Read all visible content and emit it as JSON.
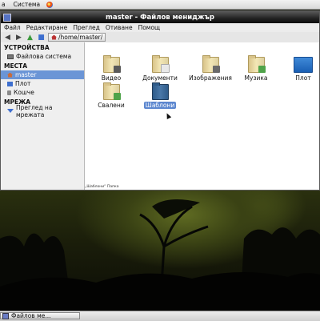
{
  "top_panel": {
    "menu_partial": "а",
    "system": "Система"
  },
  "window": {
    "title": "master - Файлов мениджър",
    "menu": [
      "Файл",
      "Редактиране",
      "Преглед",
      "Отиване",
      "Помощ"
    ],
    "path": "/home/master/",
    "status": "„Шаблони“ Папка"
  },
  "sidebar": {
    "devices_header": "УСТРОЙСТВА",
    "devices": [
      {
        "label": "Файлова система",
        "icon": "drive-icon"
      }
    ],
    "places_header": "МЕСТА",
    "places": [
      {
        "label": "master",
        "icon": "home-icon",
        "selected": true
      },
      {
        "label": "Плот",
        "icon": "desktop-icon"
      },
      {
        "label": "Кошче",
        "icon": "trash-icon"
      }
    ],
    "network_header": "МРЕЖА",
    "network": [
      {
        "label": "Преглед на мрежата",
        "icon": "network-icon"
      }
    ]
  },
  "files": [
    {
      "name": "Видео",
      "icon": "video-folder-icon",
      "emblem_color": "#5a5a5a"
    },
    {
      "name": "Документи",
      "icon": "documents-folder-icon",
      "emblem_color": "#e8e8e8"
    },
    {
      "name": "Изображения",
      "icon": "pictures-folder-icon",
      "emblem_color": "#6a6a6a"
    },
    {
      "name": "Музика",
      "icon": "music-folder-icon",
      "emblem_color": "#4fa34a"
    },
    {
      "name": "Плот",
      "icon": "desktop-folder-icon",
      "emblem_color": "#1a5fb4"
    },
    {
      "name": "Свалени",
      "icon": "downloads-folder-icon",
      "emblem_color": "#4fa34a"
    },
    {
      "name": "Шаблони",
      "icon": "templates-folder-icon",
      "emblem_color": "#2f5c8a",
      "selected": true
    }
  ],
  "taskbar": {
    "task_label": "Файлов ме..."
  }
}
